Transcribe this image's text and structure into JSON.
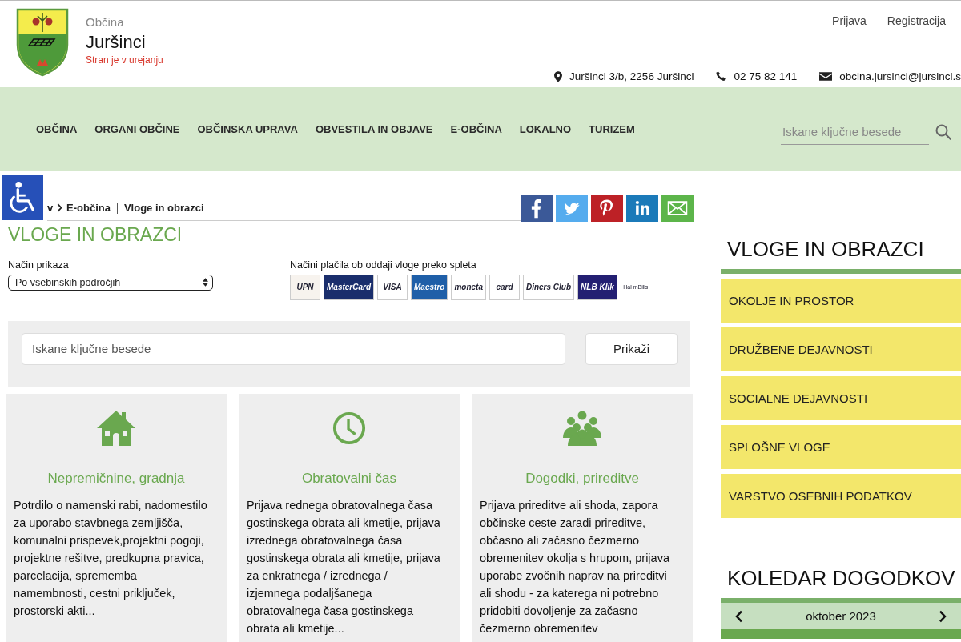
{
  "header": {
    "label": "Občina",
    "name": "Juršinci",
    "notice": "Stran je v urejanju",
    "account_links": [
      "Prijava",
      "Registracija"
    ],
    "contacts": [
      {
        "kind": "address",
        "text": "Juršinci 3/b, 2256 Juršinci"
      },
      {
        "kind": "phone",
        "text": "02 75 82 141"
      },
      {
        "kind": "email",
        "text": "obcina.jursinci@jursinci.s"
      }
    ]
  },
  "nav": {
    "items": [
      "OBČINA",
      "ORGANI OBČINE",
      "OBČINSKA UPRAVA",
      "OBVESTILA IN OBJAVE",
      "E-OBČINA",
      "LOKALNO",
      "TURIZEM"
    ],
    "search": {
      "placeholder": "Iskane ključne besede"
    }
  },
  "breadcrumb": [
    "v",
    "E-občina",
    "Vloge in obrazci"
  ],
  "share_buttons": [
    {
      "kind": "facebook",
      "color": "#3b5998"
    },
    {
      "kind": "twitter",
      "color": "#55acee"
    },
    {
      "kind": "pinterest",
      "color": "#bd2126"
    },
    {
      "kind": "linkedin",
      "color": "#1b7ab9"
    },
    {
      "kind": "email",
      "color": "#5cb54a"
    }
  ],
  "page_title": "VLOGE IN OBRAZCI",
  "view_mode": {
    "label": "Način prikaza",
    "value": "Po vsebinskih področjih"
  },
  "payments": {
    "label": "Načini plačila ob oddaji vloge preko spleta",
    "methods": [
      {
        "text": "UPN",
        "color": "#f7f3ee"
      },
      {
        "text": "MasterCard",
        "color": "#1a2e6c"
      },
      {
        "text": "VISA",
        "color": "#ffffff"
      },
      {
        "text": "Maestro",
        "color": "#1f5fa8"
      },
      {
        "text": "moneta",
        "color": "#ffffff"
      },
      {
        "text": "card",
        "color": "#ffffff"
      },
      {
        "text": "Diners Club",
        "color": "#ffffff"
      },
      {
        "text": "NLB Klik",
        "color": "#231f72"
      },
      {
        "text": "Hal mBills",
        "color": "#ffffff"
      }
    ]
  },
  "search": {
    "placeholder": "Iskane ključne besede",
    "button": "Prikaži"
  },
  "categories": [
    {
      "kind": "house",
      "title": "Nepremičnine, gradnja",
      "text": "Potrdilo o namenski rabi, nadomestilo za uporabo stavbnega zemljišča, komunalni prispevek,projektni pogoji, projektne rešitve, predkupna pravica, parcelacija, sprememba namembnosti, cestni priključek, prostorski akti..."
    },
    {
      "kind": "clock",
      "title": "Obratovalni čas",
      "text": "Prijava rednega obratovalnega časa gostinskega obrata ali kmetije, prijava izrednega obratovalnega časa gostinskega obrata ali kmetije, prijava za enkratnega / izrednega / izjemnega podaljšanega obratovalnega časa gostinskega obrata ali kmetije..."
    },
    {
      "kind": "people",
      "title": "Dogodki, prireditve",
      "text": "Prijava prireditve ali shoda, zapora občinske ceste zaradi prireditve, občasno ali začasno čezmerno obremenitev okolja s hrupom, prijava uporabe zvočnih naprav na prireditvi ali shodu - za katerega ni potrebno pridobiti dovoljenje za začasno čezmerno obremenitev"
    }
  ],
  "sidebar": {
    "title": "VLOGE IN OBRAZCI",
    "items": [
      "OKOLJE IN PROSTOR",
      "DRUŽBENE DEJAVNOSTI",
      "SOCIALNE DEJAVNOSTI",
      "SPLOŠNE VLOGE",
      "VARSTVO OSEBNIH PODATKOV"
    ]
  },
  "calendar": {
    "title": "KOLEDAR DOGODKOV",
    "month": "oktober 2023"
  }
}
